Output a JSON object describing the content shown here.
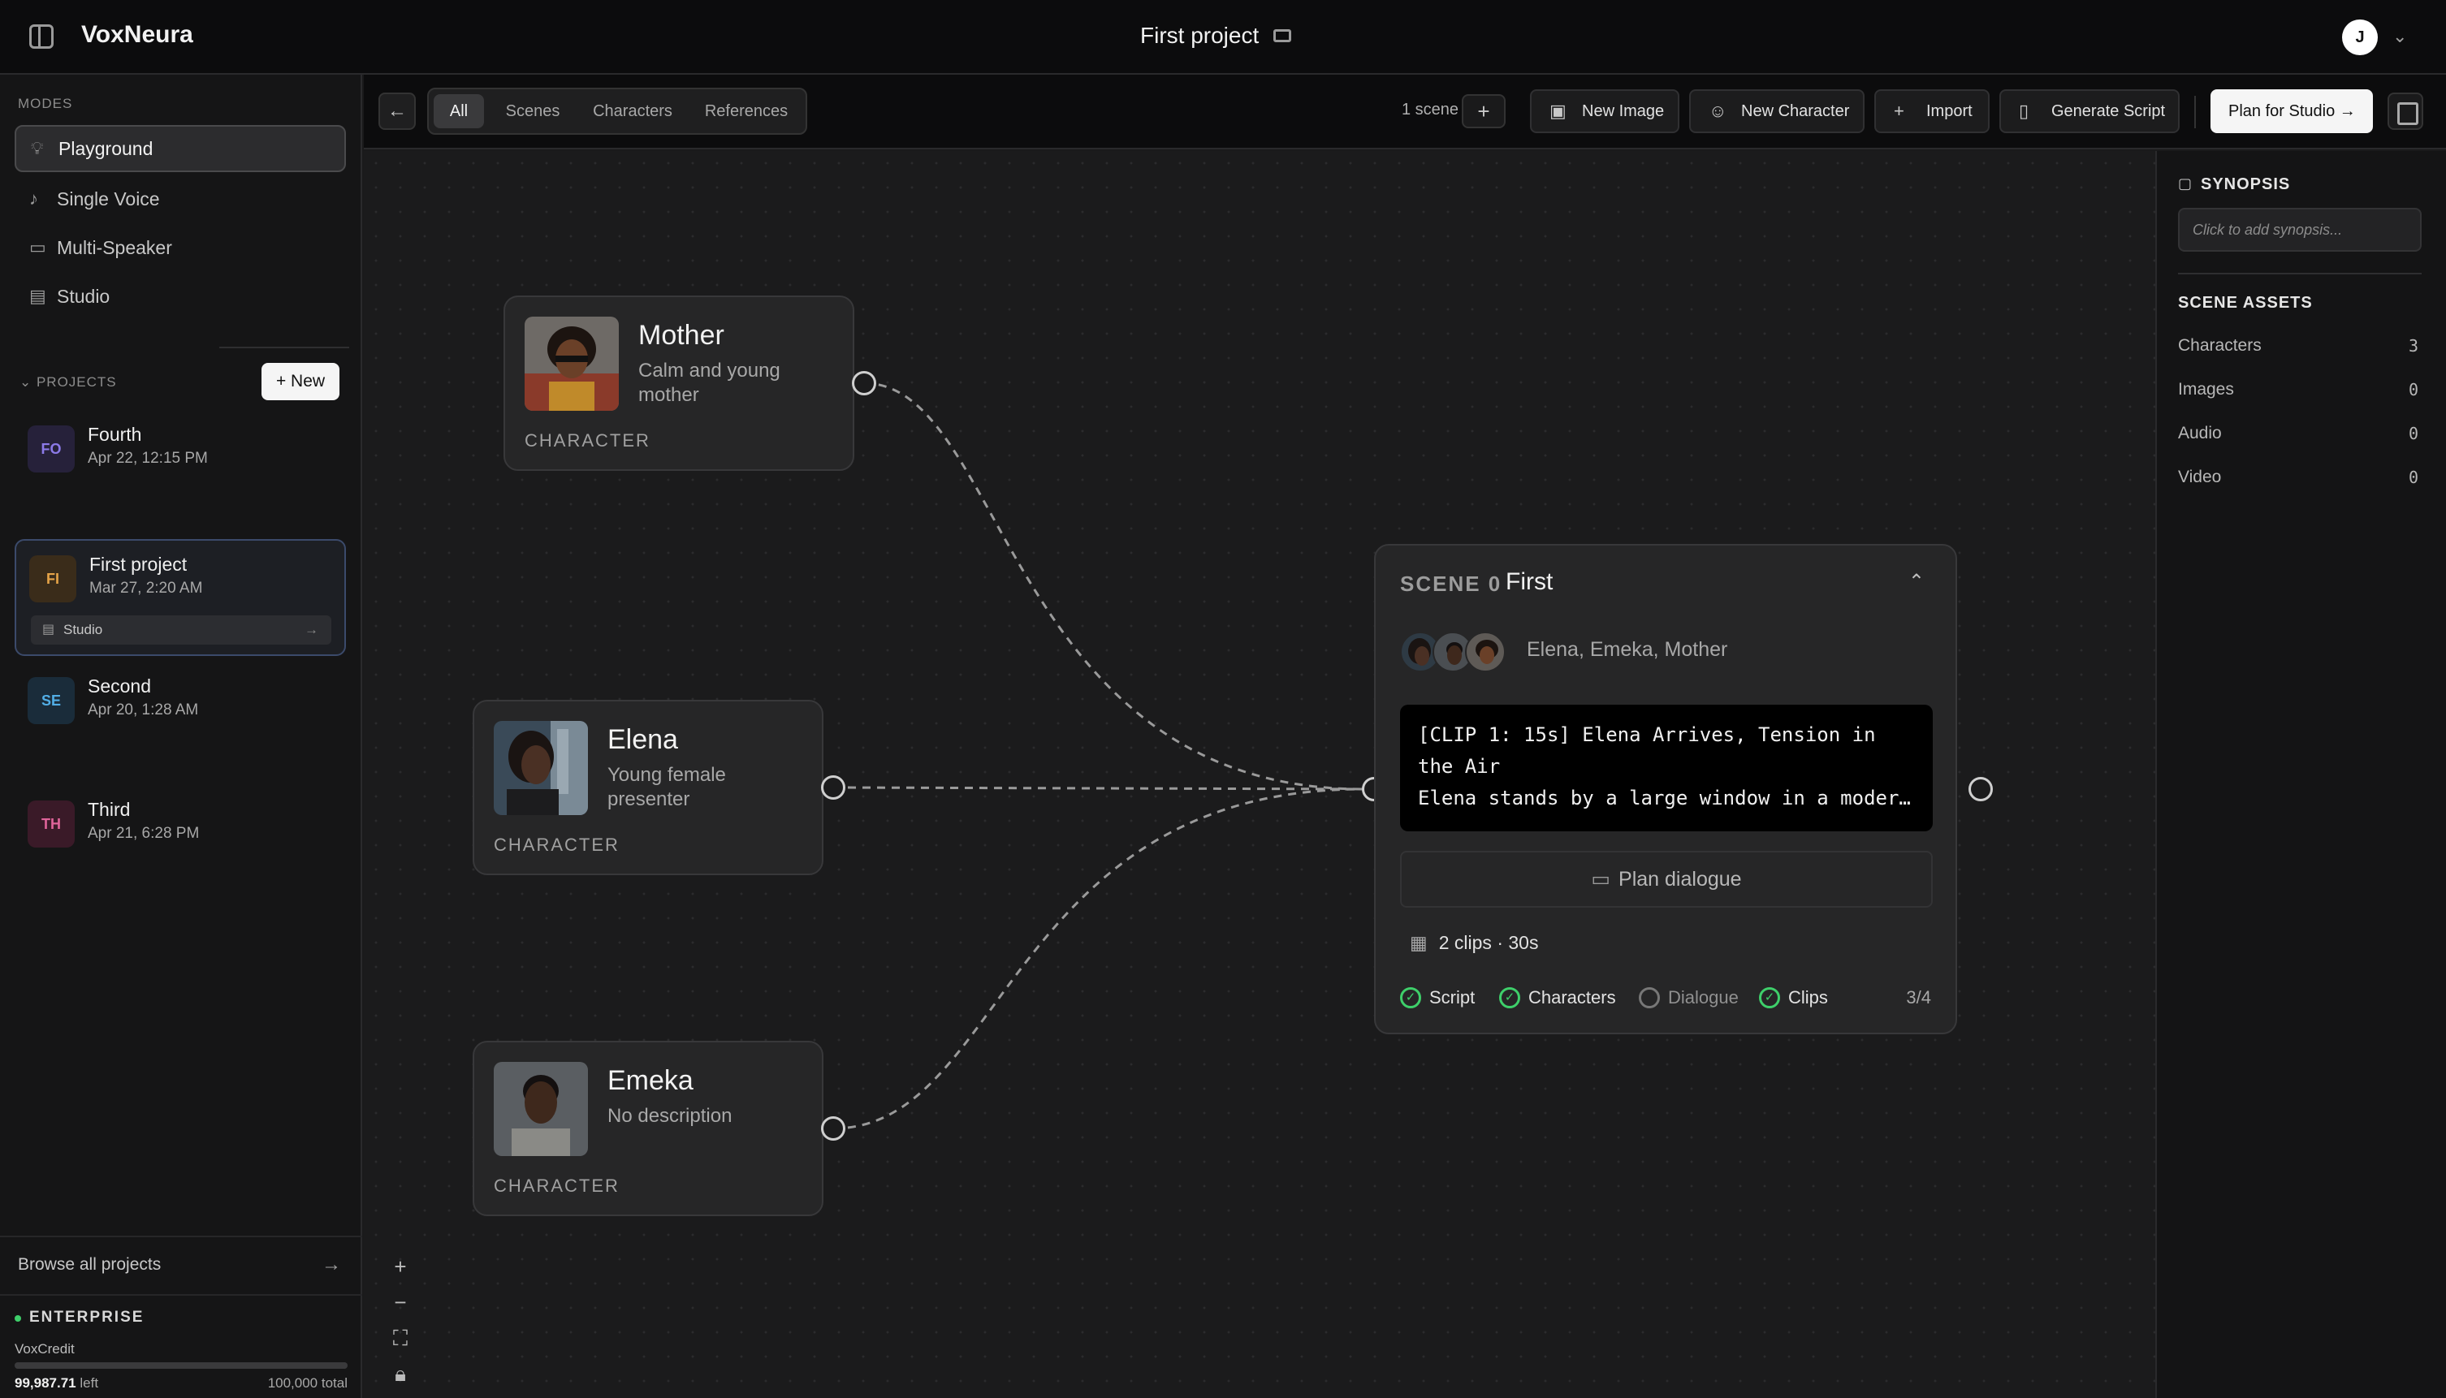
{
  "app": {
    "brand": "VoxNeura",
    "project_title": "First project",
    "user_initial": "J"
  },
  "sidebar": {
    "modes_label": "MODES",
    "modes": [
      {
        "label": "Playground",
        "icon": "lightbulb-icon",
        "active": true
      },
      {
        "label": "Single Voice",
        "icon": "microphone-icon",
        "active": false
      },
      {
        "label": "Multi-Speaker",
        "icon": "chat-icon",
        "active": false
      },
      {
        "label": "Studio",
        "icon": "clapperboard-icon",
        "active": false
      }
    ],
    "projects_label": "PROJECTS",
    "new_label": "New",
    "projects": [
      {
        "initials": "FO",
        "name": "Fourth",
        "date": "Apr 22, 12:15 PM",
        "color": "#6a5acd"
      },
      {
        "initials": "FI",
        "name": "First project",
        "date": "Mar 27, 2:20 AM",
        "color": "#e0a040",
        "chip": "Studio"
      },
      {
        "initials": "SE",
        "name": "Second",
        "date": "Apr 20, 1:28 AM",
        "color": "#4aa0d8"
      },
      {
        "initials": "TH",
        "name": "Third",
        "date": "Apr 21, 6:28 PM",
        "color": "#d05a8a"
      }
    ],
    "browse_label": "Browse all projects",
    "plan": {
      "tier": "ENTERPRISE",
      "credit_label": "VoxCredit",
      "left_value": "99,987.71",
      "left_suffix": "left",
      "total": "100,000 total",
      "used_fraction": 0.9998771
    }
  },
  "toolbar": {
    "tabs": [
      "All",
      "Scenes",
      "Characters",
      "References"
    ],
    "active_tab": "All",
    "scene_count": "1 scene",
    "buttons": {
      "new_image": "New Image",
      "new_character": "New Character",
      "import": "Import",
      "generate_script": "Generate Script",
      "plan_for_studio": "Plan for Studio"
    }
  },
  "canvas": {
    "characters": [
      {
        "name": "Mother",
        "description": "Calm and young mother",
        "type": "CHARACTER"
      },
      {
        "name": "Elena",
        "description": "Young female presenter",
        "type": "CHARACTER"
      },
      {
        "name": "Emeka",
        "description": "No description",
        "type": "CHARACTER"
      }
    ],
    "scene": {
      "label": "SCENE 0",
      "title": "First",
      "cast": "Elena, Emeka, Mother",
      "script_line1": "[CLIP 1: 15s] Elena Arrives, Tension in the Air",
      "script_line2": "Elena stands by a large window in a modern, minimalist office.",
      "plan_dialogue": "Plan dialogue",
      "clips": "2 clips · 30s",
      "checks": [
        {
          "label": "Script",
          "done": true
        },
        {
          "label": "Characters",
          "done": true
        },
        {
          "label": "Dialogue",
          "done": false
        },
        {
          "label": "Clips",
          "done": true
        }
      ],
      "progress": "3/4"
    }
  },
  "panel": {
    "synopsis_label": "SYNOPSIS",
    "synopsis_placeholder": "Click to add synopsis...",
    "assets_label": "SCENE ASSETS",
    "assets": [
      {
        "label": "Characters",
        "value": "3"
      },
      {
        "label": "Images",
        "value": "0"
      },
      {
        "label": "Audio",
        "value": "0"
      },
      {
        "label": "Video",
        "value": "0"
      }
    ]
  }
}
